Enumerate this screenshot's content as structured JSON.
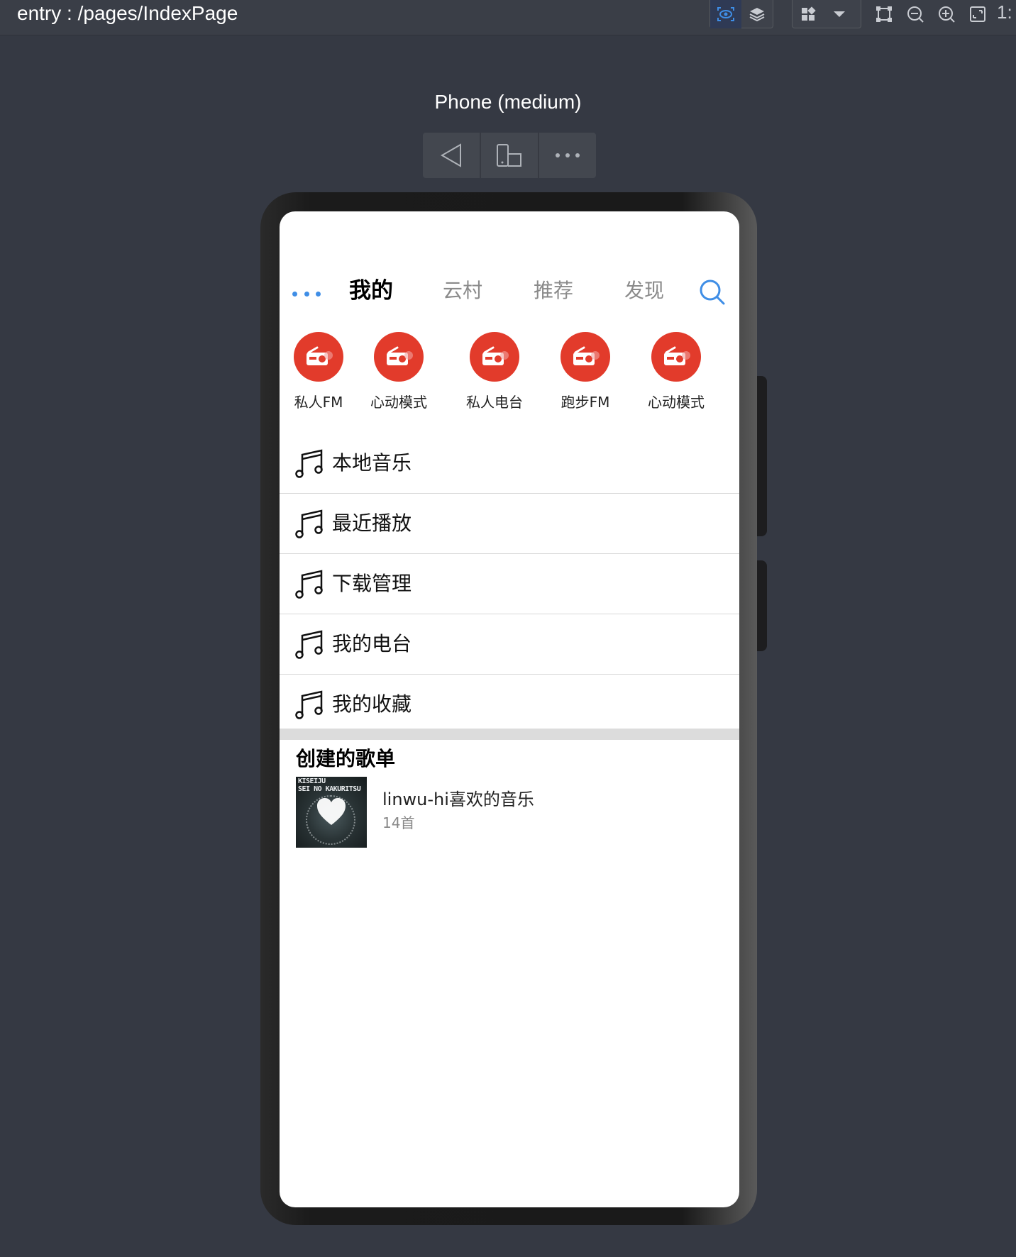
{
  "ide": {
    "path": "entry : /pages/IndexPage",
    "zoom_label": "1:",
    "device_label": "Phone (medium)"
  },
  "app": {
    "tabs": [
      {
        "label": "我的",
        "active": true
      },
      {
        "label": "云村",
        "active": false
      },
      {
        "label": "推荐",
        "active": false
      },
      {
        "label": "发现",
        "active": false
      }
    ],
    "quick_entries": [
      {
        "label": "私人FM",
        "icon": "radio-icon"
      },
      {
        "label": "心动模式",
        "icon": "radio-icon"
      },
      {
        "label": "私人电台",
        "icon": "radio-icon"
      },
      {
        "label": "跑步FM",
        "icon": "radio-icon"
      },
      {
        "label": "心动模式",
        "icon": "radio-icon"
      }
    ],
    "menu": [
      {
        "label": "本地音乐",
        "icon": "music-note-icon"
      },
      {
        "label": "最近播放",
        "icon": "music-note-icon"
      },
      {
        "label": "下载管理",
        "icon": "music-note-icon"
      },
      {
        "label": "我的电台",
        "icon": "music-note-icon"
      },
      {
        "label": "我的收藏",
        "icon": "music-note-icon"
      }
    ],
    "created_playlists": {
      "title": "创建的歌单",
      "items": [
        {
          "name": "linwu-hi喜欢的音乐",
          "count": "14首",
          "cover_text": [
            "KISEIJU",
            "SEI NO KAKURITSU"
          ]
        }
      ]
    },
    "colors": {
      "accent_blue": "#3f8ee6",
      "brand_red": "#e23b2b"
    }
  }
}
